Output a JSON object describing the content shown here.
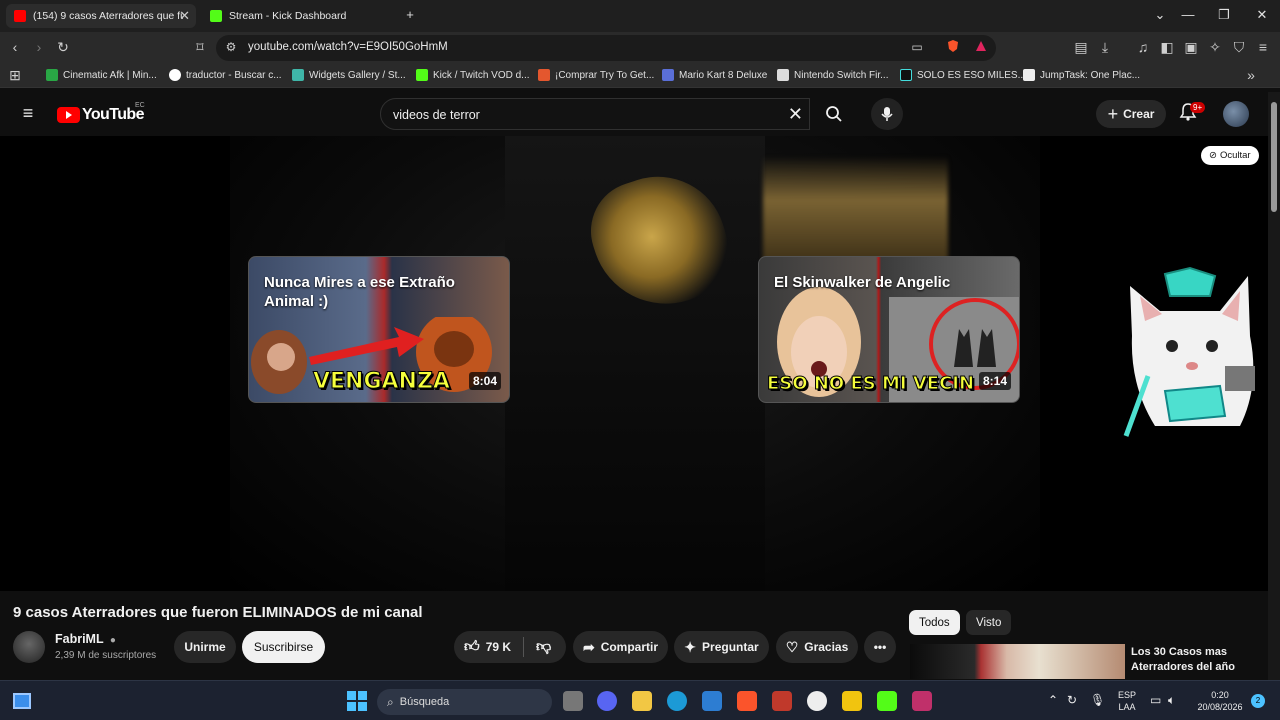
{
  "browser": {
    "tabs": [
      {
        "label": "(154) 9 casos Aterradores que fu",
        "active": true
      },
      {
        "label": "Stream - Kick Dashboard",
        "active": false
      }
    ],
    "url": "youtube.com/watch?v=E9OI50GoHmM",
    "bookmarks": [
      "Cinematic Afk | Min...",
      "traductor - Buscar c...",
      "Widgets Gallery / St...",
      "Kick / Twitch VOD d...",
      "¡Comprar Try To Get...",
      "Mario Kart 8 Deluxe",
      "Nintendo Switch Fir...",
      "SOLO ES ESO MILES...",
      "JumpTask: One Plac..."
    ],
    "colors": {
      "accent": "#ff0000",
      "kick": "#53fc18"
    }
  },
  "youtube": {
    "logo_text": "YouTube",
    "country_code": "EC",
    "search_value": "videos de terror",
    "create_label": "Crear",
    "notification_badge": "9+"
  },
  "player": {
    "hide_label": "Ocultar",
    "endcards": [
      {
        "title": "Nunca Mires a ese Extraño Animal :)",
        "overlay": "VENGANZA",
        "duration": "8:04"
      },
      {
        "title": "El Skinwalker de Angelic",
        "overlay": "ESO NO ES MI VECIN",
        "duration": "8:14"
      }
    ]
  },
  "video": {
    "title": "9 casos Aterradores que fueron ELIMINADOS de mi canal",
    "channel": "FabriML",
    "subscribers": "2,39 M de suscriptores",
    "join_label": "Unirme",
    "subscribe_label": "Suscribirse",
    "likes": "79 K",
    "share_label": "Compartir",
    "ask_label": "Preguntar",
    "thanks_label": "Gracias"
  },
  "sidebar": {
    "chips": [
      "Todos",
      "Visto"
    ],
    "recommended_title": "Los 30 Casos mas Aterradores del año"
  },
  "taskbar": {
    "search_placeholder": "Búsqueda",
    "lang_top": "ESP",
    "lang_bottom": "LAA",
    "time": "0:20",
    "date": "20/08/2026",
    "notif_count": "2"
  }
}
